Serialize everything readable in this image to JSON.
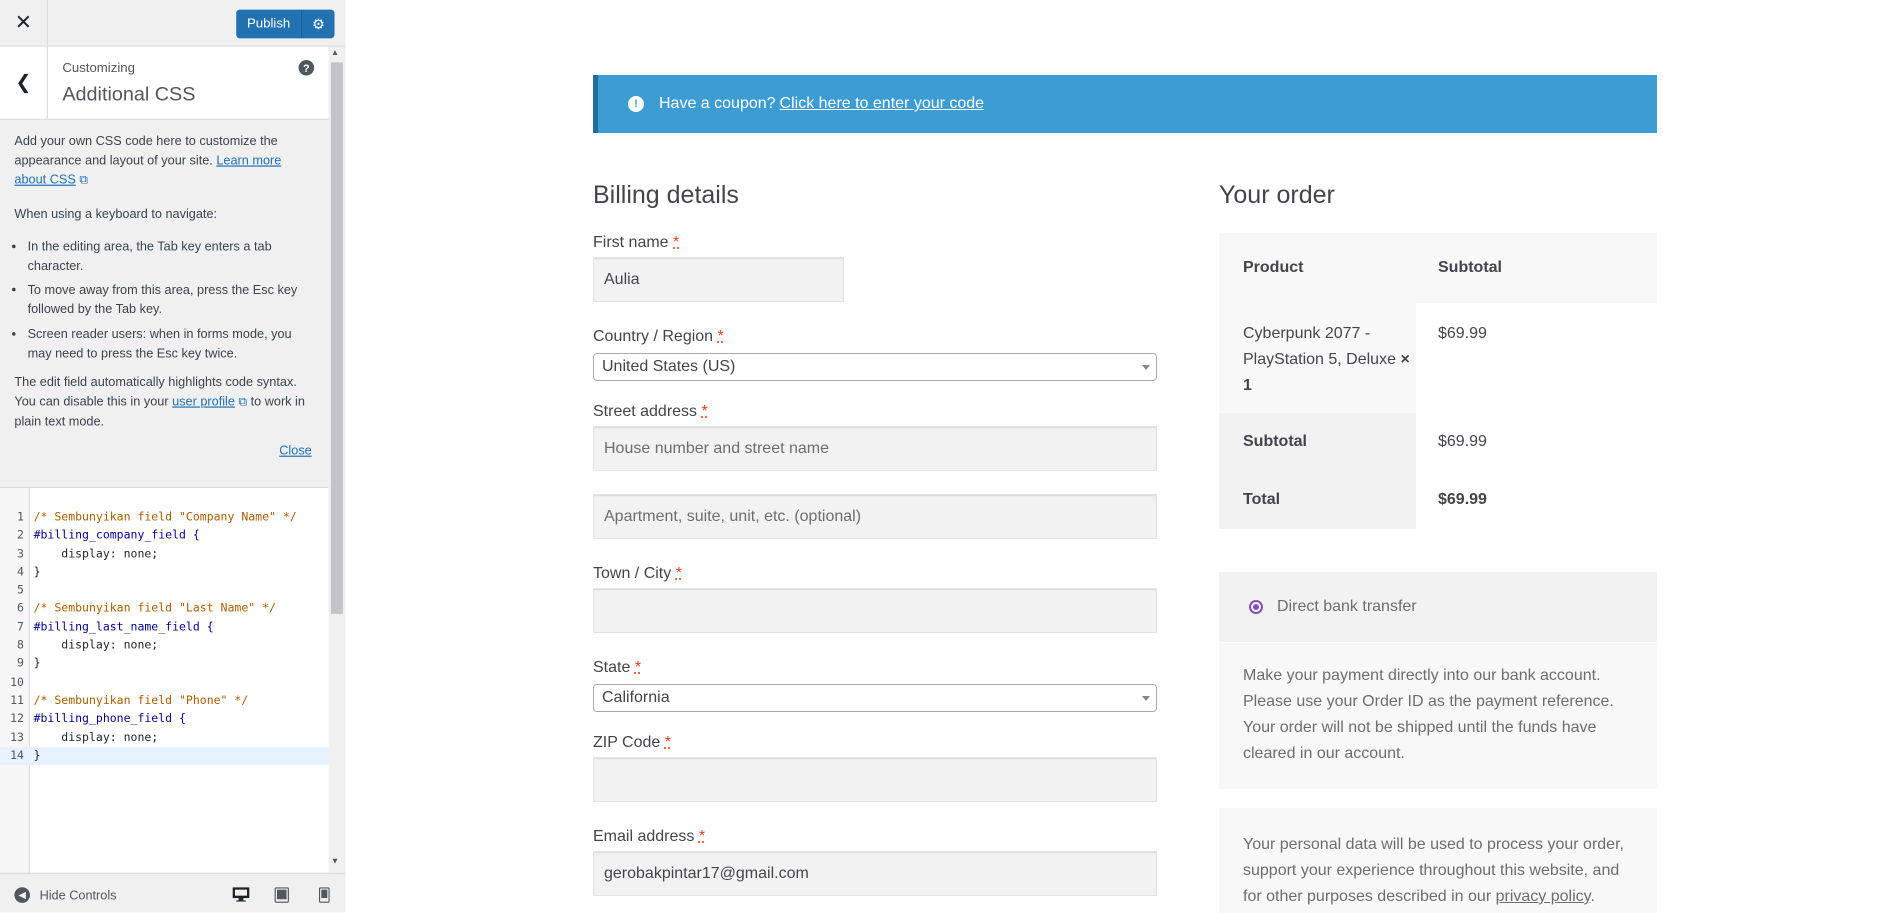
{
  "topbar": {
    "close_icon": "close-icon",
    "publish_label": "Publish",
    "settings_icon": "gear-icon"
  },
  "section": {
    "breadcrumb": "Customizing",
    "title": "Additional CSS",
    "help_icon": "help-icon"
  },
  "description": {
    "intro_pre": "Add your own CSS code here to customize the appearance and layout of your site.",
    "learn_more": "Learn more about CSS",
    "keyboard": "When using a keyboard to navigate:",
    "bullets": [
      "In the editing area, the Tab key enters a tab character.",
      "To move away from this area, press the Esc key followed by the Tab key.",
      "Screen reader users: when in forms mode, you may need to press the Esc key twice."
    ],
    "highlight_pre": "The edit field automatically highlights code syntax. You can disable this in your",
    "user_profile": "user profile",
    "highlight_post": "to work in plain text mode.",
    "close": "Close"
  },
  "code": {
    "lines": [
      {
        "n": "1",
        "text": "/* Sembunyikan field \"Company Name\" */",
        "kind": "comment"
      },
      {
        "n": "2",
        "text": "#billing_company_field {",
        "kind": "selector"
      },
      {
        "n": "3",
        "text": "    display: none;",
        "kind": "prop"
      },
      {
        "n": "4",
        "text": "}",
        "kind": "prop"
      },
      {
        "n": "5",
        "text": "",
        "kind": "prop"
      },
      {
        "n": "6",
        "text": "/* Sembunyikan field \"Last Name\" */",
        "kind": "comment"
      },
      {
        "n": "7",
        "text": "#billing_last_name_field {",
        "kind": "selector"
      },
      {
        "n": "8",
        "text": "    display: none;",
        "kind": "prop"
      },
      {
        "n": "9",
        "text": "}",
        "kind": "prop"
      },
      {
        "n": "10",
        "text": "",
        "kind": "prop"
      },
      {
        "n": "11",
        "text": "/* Sembunyikan field \"Phone\" */",
        "kind": "comment"
      },
      {
        "n": "12",
        "text": "#billing_phone_field {",
        "kind": "selector"
      },
      {
        "n": "13",
        "text": "    display: none;",
        "kind": "prop"
      },
      {
        "n": "14",
        "text": "}",
        "kind": "prop"
      }
    ]
  },
  "footer": {
    "hide_controls": "Hide Controls",
    "devices": [
      "desktop-icon",
      "tablet-icon",
      "mobile-icon"
    ]
  },
  "coupon": {
    "text": "Have a coupon?",
    "link": "Click here to enter your code"
  },
  "billing": {
    "heading": "Billing details",
    "first_name_label": "First name",
    "first_name_value": "Aulia",
    "country_label": "Country / Region",
    "country_value": "United States (US)",
    "street_label": "Street address",
    "street_placeholder": "House number and street name",
    "apartment_placeholder": "Apartment, suite, unit, etc. (optional)",
    "city_label": "Town / City",
    "state_label": "State",
    "state_value": "California",
    "zip_label": "ZIP Code",
    "email_label": "Email address",
    "email_value": "gerobakpintar17@gmail.com",
    "required_mark": "*"
  },
  "order": {
    "heading": "Your order",
    "col_product": "Product",
    "col_subtotal": "Subtotal",
    "item_name": "Cyberpunk 2077 - PlayStation 5, Deluxe",
    "item_qty": "× 1",
    "item_price": "$69.99",
    "subtotal_label": "Subtotal",
    "subtotal_value": "$69.99",
    "total_label": "Total",
    "total_value": "$69.99"
  },
  "payment": {
    "method": "Direct bank transfer",
    "description": "Make your payment directly into our bank account. Please use your Order ID as the payment reference. Your order will not be shipped until the funds have cleared in our account."
  },
  "privacy": {
    "text": "Your personal data will be used to process your order, support your experience throughout this website, and for other purposes described in our",
    "link": "privacy policy",
    "end": "."
  },
  "colors": {
    "accent": "#2271b1",
    "coupon_bg": "#3d9cd2",
    "radio": "#7f54b3"
  }
}
